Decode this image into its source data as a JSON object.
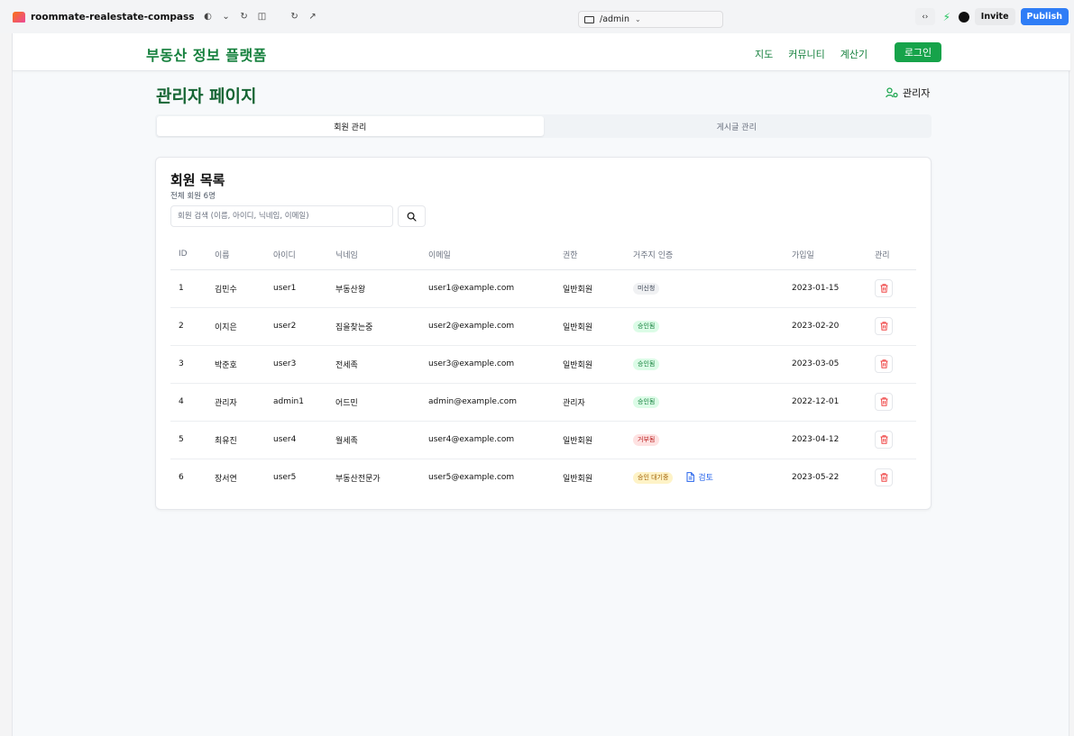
{
  "browser": {
    "project_name": "roommate-realestate-compass",
    "url": "/admin",
    "invite_label": "Invite",
    "publish_label": "Publish",
    "code_label": "‹›"
  },
  "header": {
    "brand": "부동산 정보 플랫폼",
    "nav": [
      "지도",
      "커뮤니티",
      "계산기"
    ],
    "login_label": "로그인"
  },
  "page": {
    "title": "관리자 페이지",
    "role_badge": "관리자"
  },
  "tabs": [
    {
      "label": "회원 관리",
      "active": true
    },
    {
      "label": "게시글 관리",
      "active": false
    }
  ],
  "members": {
    "title": "회원 목록",
    "subtitle": "전체 회원 6명",
    "search_placeholder": "회원 검색 (이름, 아이디, 닉네임, 이메일)",
    "columns": [
      "ID",
      "이름",
      "아이디",
      "닉네임",
      "이메일",
      "권한",
      "거주지 인증",
      "가입일",
      "관리"
    ],
    "review_label": "검토",
    "rows": [
      {
        "id": "1",
        "name": "김민수",
        "username": "user1",
        "nickname": "부동산왕",
        "email": "user1@example.com",
        "role": "일반회원",
        "residence": "미신청",
        "residence_color": "gray",
        "joined": "2023-01-15"
      },
      {
        "id": "2",
        "name": "이지은",
        "username": "user2",
        "nickname": "집을찾는중",
        "email": "user2@example.com",
        "role": "일반회원",
        "residence": "승인됨",
        "residence_color": "green",
        "joined": "2023-02-20"
      },
      {
        "id": "3",
        "name": "박준호",
        "username": "user3",
        "nickname": "전세족",
        "email": "user3@example.com",
        "role": "일반회원",
        "residence": "승인됨",
        "residence_color": "green",
        "joined": "2023-03-05"
      },
      {
        "id": "4",
        "name": "관리자",
        "username": "admin1",
        "nickname": "어드민",
        "email": "admin@example.com",
        "role": "관리자",
        "residence": "승인됨",
        "residence_color": "green",
        "joined": "2022-12-01"
      },
      {
        "id": "5",
        "name": "최유진",
        "username": "user4",
        "nickname": "월세족",
        "email": "user4@example.com",
        "role": "일반회원",
        "residence": "거부됨",
        "residence_color": "red",
        "joined": "2023-04-12"
      },
      {
        "id": "6",
        "name": "장서연",
        "username": "user5",
        "nickname": "부동산전문가",
        "email": "user5@example.com",
        "role": "일반회원",
        "residence": "승인 대기중",
        "residence_color": "yellow",
        "joined": "2023-05-22"
      }
    ]
  },
  "colors": {
    "brand_green": "#15803d",
    "button_green": "#16a34a",
    "publish_blue": "#2f7df6",
    "delete_red": "#ef4444",
    "link_blue": "#2563eb"
  },
  "icons": {
    "search": "search-icon",
    "delete": "trash-icon",
    "review": "document-icon",
    "role": "user-cog-icon"
  }
}
